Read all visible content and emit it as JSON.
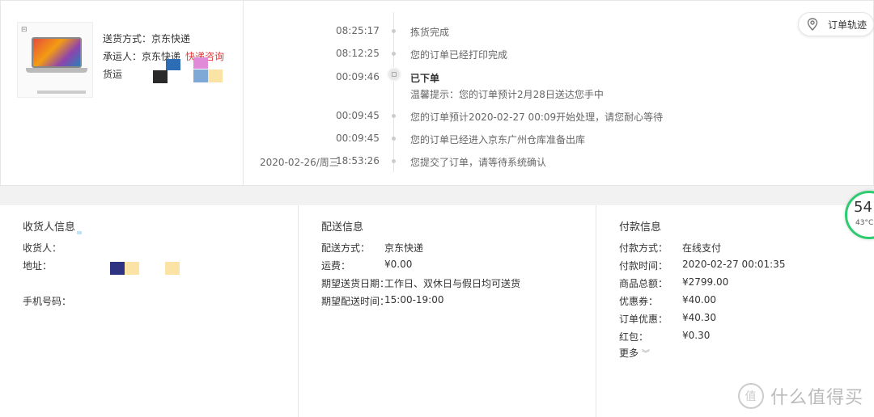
{
  "shipping_summary": {
    "method_label": "送货方式：",
    "method_value": "京东快递",
    "carrier_label": "承运人：",
    "carrier_value": "京东快递",
    "courier_link": "快递咨询",
    "waybill_label": "货运"
  },
  "track_button": {
    "label": "订单轨迹",
    "icon": "location-pin-icon"
  },
  "timeline": [
    {
      "date": "",
      "time": "08:25:17",
      "text": "拣货完成",
      "bold": false
    },
    {
      "date": "",
      "time": "08:12:25",
      "text": "您的订单已经打印完成",
      "bold": false
    },
    {
      "date": "",
      "time": "00:09:46",
      "text": "已下单",
      "bold": true,
      "note": "温馨提示：您的订单预计2月28日送达您手中"
    },
    {
      "date": "",
      "time": "00:09:45",
      "text": "您的订单预计2020-02-27 00:09开始处理，请您耐心等待",
      "bold": false
    },
    {
      "date": "",
      "time": "00:09:45",
      "text": "您的订单已经进入京东广州仓库准备出库",
      "bold": false
    },
    {
      "date": "2020-02-26/周三",
      "time": "18:53:26",
      "text": "您提交了订单，请等待系统确认",
      "bold": false
    }
  ],
  "receiver": {
    "title": "收货人信息",
    "name_label": "收货人：",
    "address_label": "地址：",
    "phone_label": "手机号码："
  },
  "delivery": {
    "title": "配送信息",
    "rows": [
      {
        "k": "配送方式：",
        "v": "京东快递"
      },
      {
        "k": "运费：",
        "v": "¥0.00"
      },
      {
        "k": "期望送货日期：",
        "v": "工作日、双休日与假日均可送货"
      },
      {
        "k": "期望配送时间：",
        "v": "15:00-19:00"
      }
    ]
  },
  "payment": {
    "title": "付款信息",
    "rows": [
      {
        "k": "付款方式：",
        "v": "在线支付"
      },
      {
        "k": "付款时间：",
        "v": "2020-02-27 00:01:35"
      },
      {
        "k": "商品总额：",
        "v": "¥2799.00"
      },
      {
        "k": "优惠券：",
        "v": "¥40.00"
      },
      {
        "k": "订单优惠：",
        "v": "¥40.30"
      },
      {
        "k": "红包：",
        "v": "¥0.30"
      }
    ],
    "more_label": "更多"
  },
  "gauge": {
    "value": "54",
    "temp": "43°C"
  },
  "watermark": {
    "text": "什么值得买",
    "logo": "值"
  },
  "colors": {
    "accent_red": "#e4393c",
    "gauge_green": "#2ecc71"
  }
}
